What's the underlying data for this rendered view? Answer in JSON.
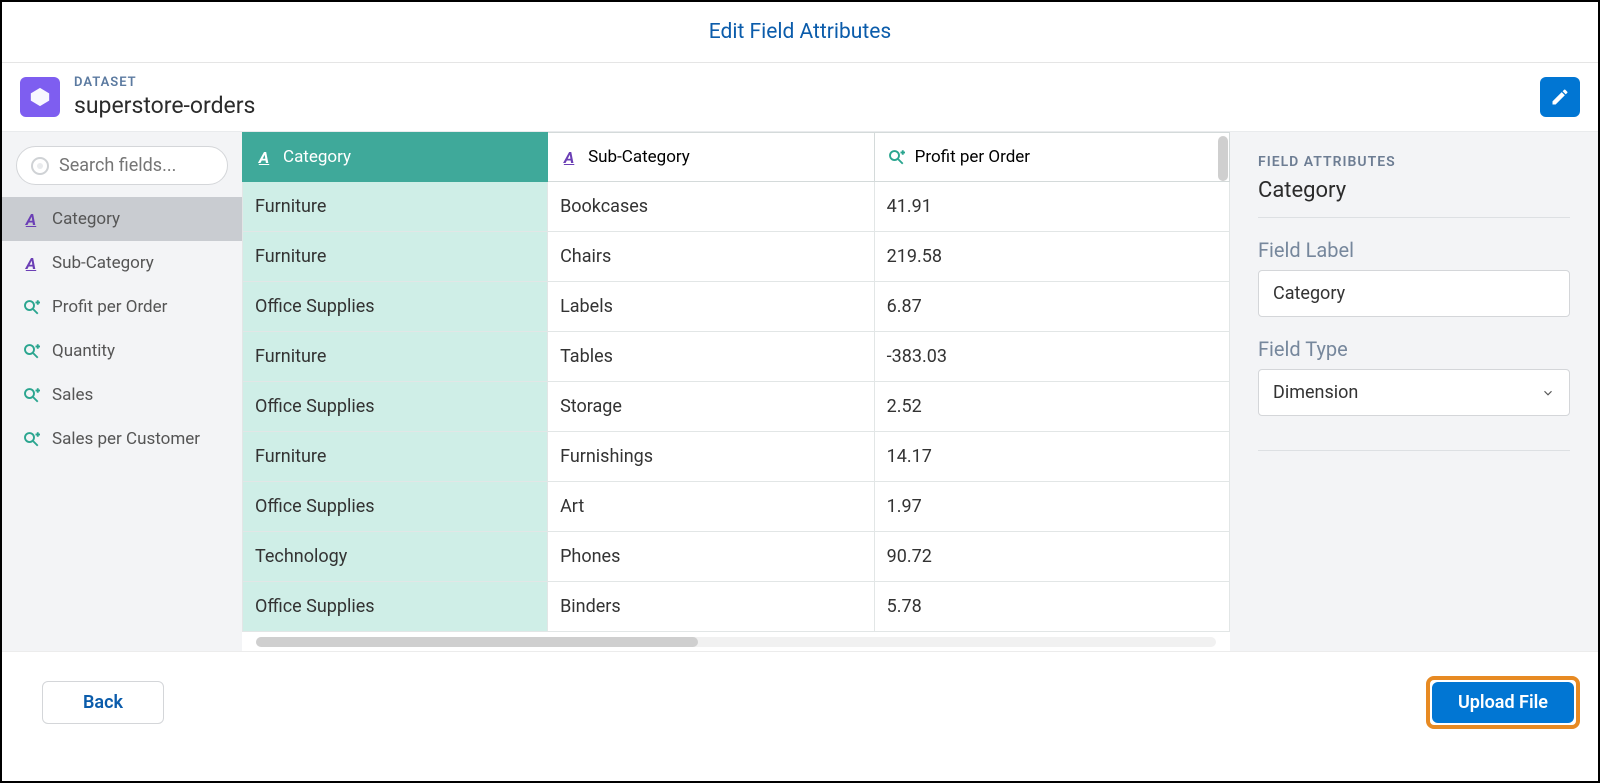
{
  "header": {
    "title": "Edit Field Attributes"
  },
  "dataset": {
    "label": "DATASET",
    "name": "superstore-orders"
  },
  "sidebar": {
    "search_placeholder": "Search fields...",
    "fields": [
      {
        "label": "Category",
        "type": "dimension",
        "selected": true
      },
      {
        "label": "Sub-Category",
        "type": "dimension",
        "selected": false
      },
      {
        "label": "Profit per Order",
        "type": "measure",
        "selected": false
      },
      {
        "label": "Quantity",
        "type": "measure",
        "selected": false
      },
      {
        "label": "Sales",
        "type": "measure",
        "selected": false
      },
      {
        "label": "Sales per Customer",
        "type": "measure",
        "selected": false
      }
    ]
  },
  "table": {
    "columns": [
      {
        "label": "Category",
        "type": "dimension",
        "selected": true
      },
      {
        "label": "Sub-Category",
        "type": "dimension",
        "selected": false
      },
      {
        "label": "Profit per Order",
        "type": "measure",
        "selected": false
      }
    ],
    "rows": [
      {
        "Category": "Furniture",
        "Sub-Category": "Bookcases",
        "Profit per Order": "41.91"
      },
      {
        "Category": "Furniture",
        "Sub-Category": "Chairs",
        "Profit per Order": "219.58"
      },
      {
        "Category": "Office Supplies",
        "Sub-Category": "Labels",
        "Profit per Order": "6.87"
      },
      {
        "Category": "Furniture",
        "Sub-Category": "Tables",
        "Profit per Order": "-383.03"
      },
      {
        "Category": "Office Supplies",
        "Sub-Category": "Storage",
        "Profit per Order": "2.52"
      },
      {
        "Category": "Furniture",
        "Sub-Category": "Furnishings",
        "Profit per Order": "14.17"
      },
      {
        "Category": "Office Supplies",
        "Sub-Category": "Art",
        "Profit per Order": "1.97"
      },
      {
        "Category": "Technology",
        "Sub-Category": "Phones",
        "Profit per Order": "90.72"
      },
      {
        "Category": "Office Supplies",
        "Sub-Category": "Binders",
        "Profit per Order": "5.78"
      }
    ]
  },
  "attributes": {
    "heading": "FIELD ATTRIBUTES",
    "field_name": "Category",
    "label_caption": "Field Label",
    "label_value": "Category",
    "type_caption": "Field Type",
    "type_value": "Dimension"
  },
  "footer": {
    "back_label": "Back",
    "upload_label": "Upload File"
  }
}
